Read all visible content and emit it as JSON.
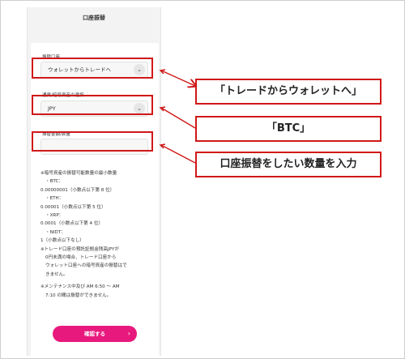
{
  "screen": {
    "title": "口座振替"
  },
  "form": {
    "transfer_account": {
      "label": "振替口座",
      "value": "ウォレットからトレードへ"
    },
    "currency": {
      "label": "通貨/暗号資産の選択",
      "value": "JPY"
    },
    "amount": {
      "label": "振替金額/数量",
      "value": ""
    }
  },
  "notes": {
    "min_title": "※暗号資産の振替可能数量の最小数量",
    "btc_name": "・BTC：",
    "btc_value": "0.00000001（小数点以下第 8 位）",
    "eth_name": "・ETH：",
    "eth_value": "0.00001（小数点以下第 5 位）",
    "xrp_name": "・XRP：",
    "xrp_value": "0.0001（小数点以下第 4 位）",
    "nidt_name": "・NIDT：",
    "nidt_value": "1（小数点以下なし）",
    "jpy_line1": "※トレード口座の預託証拠金残高JPYが",
    "jpy_line2": "0円未満の場合、トレード口座から",
    "jpy_line3": "ウォレット口座への暗号資産の振替はで",
    "jpy_line4": "きません。",
    "maint_line1": "※メンテナンス中及び AM 6:50 〜 AM",
    "maint_line2": "7:10 の間は振替ができません。"
  },
  "confirm_button": {
    "label": "確認する",
    "arrow": "›"
  },
  "callouts": {
    "trade_to_wallet": "「トレードからウォレットへ」",
    "btc": "「BTC」",
    "enter_amount": "口座振替をしたい数量を入力"
  },
  "colors": {
    "highlight": "#d01818",
    "button": "#e8197d"
  },
  "icons": {
    "dropdown": "chevron-down-icon",
    "button_arrow": "chevron-right-icon"
  }
}
